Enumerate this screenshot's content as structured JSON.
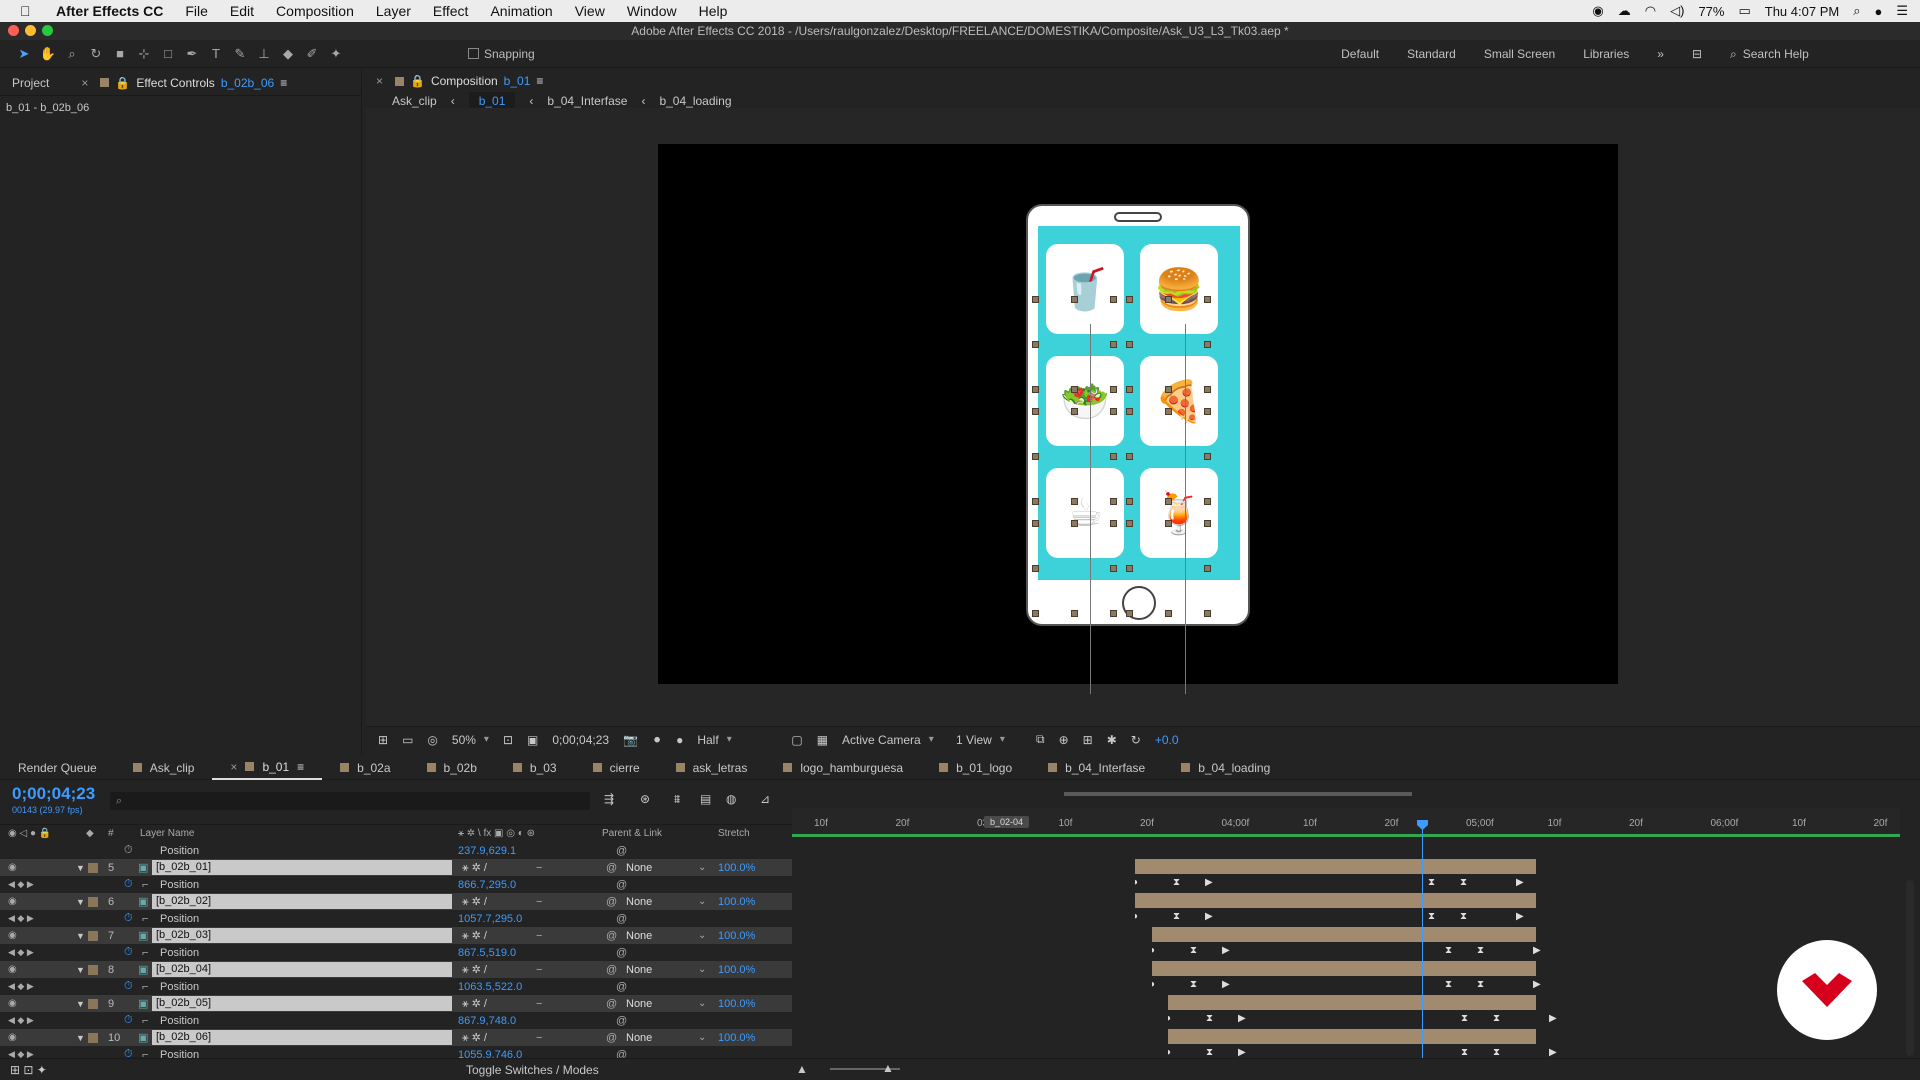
{
  "menubar": {
    "app": "After Effects CC",
    "items": [
      "File",
      "Edit",
      "Composition",
      "Layer",
      "Effect",
      "Animation",
      "View",
      "Window",
      "Help"
    ],
    "battery": "77%",
    "clock": "Thu 4:07 PM"
  },
  "window_title": "Adobe After Effects CC 2018 - /Users/raulgonzalez/Desktop/FREELANCE/DOMESTIKA/Composite/Ask_U3_L3_Tk03.aep *",
  "toolbar": {
    "snapping": "Snapping",
    "workspaces": [
      "Default",
      "Standard",
      "Small Screen",
      "Libraries"
    ],
    "search_placeholder": "Search Help"
  },
  "left_panel": {
    "tab_project": "Project",
    "tab_effect_controls": "Effect Controls",
    "effect_layer": "b_02b_06",
    "path": "b_01 - b_02b_06"
  },
  "comp_panel": {
    "tab_label": "Composition",
    "comp_name": "b_01",
    "crumbs": [
      "Ask_clip",
      "b_01",
      "b_04_Interfase",
      "b_04_loading"
    ]
  },
  "viewer_footer": {
    "zoom": "50%",
    "timecode": "0;00;04;23",
    "resolution": "Half",
    "camera": "Active Camera",
    "views": "1 View",
    "exposure": "+0.0"
  },
  "timeline_tabs": [
    "Render Queue",
    "Ask_clip",
    "b_01",
    "b_02a",
    "b_02b",
    "b_03",
    "cierre",
    "ask_letras",
    "logo_hamburguesa",
    "b_01_logo",
    "b_04_Interfase",
    "b_04_loading"
  ],
  "timeline": {
    "timecode": "0;00;04;23",
    "frame_info": "00143 (29.97 fps)",
    "col_layer_name": "Layer Name",
    "col_parent": "Parent & Link",
    "col_stretch": "Stretch",
    "col_hash": "#",
    "ruler_labels": [
      "10f",
      "20f",
      "03;00f",
      "10f",
      "20f",
      "04;00f",
      "10f",
      "20f",
      "05;00f",
      "10f",
      "20f",
      "06;00f",
      "10f",
      "20f"
    ],
    "marker_label": "b_02-04",
    "rows": [
      {
        "kind": "prop",
        "name": "Position",
        "value": "237.9,629.1"
      },
      {
        "kind": "layer",
        "num": "5",
        "name": "[b_02b_01]",
        "parent": "None",
        "stretch": "100.0%"
      },
      {
        "kind": "prop",
        "name": "Position",
        "value": "866.7,295.0"
      },
      {
        "kind": "layer",
        "num": "6",
        "name": "[b_02b_02]",
        "parent": "None",
        "stretch": "100.0%"
      },
      {
        "kind": "prop",
        "name": "Position",
        "value": "1057.7,295.0"
      },
      {
        "kind": "layer",
        "num": "7",
        "name": "[b_02b_03]",
        "parent": "None",
        "stretch": "100.0%"
      },
      {
        "kind": "prop",
        "name": "Position",
        "value": "867.5,519.0"
      },
      {
        "kind": "layer",
        "num": "8",
        "name": "[b_02b_04]",
        "parent": "None",
        "stretch": "100.0%"
      },
      {
        "kind": "prop",
        "name": "Position",
        "value": "1063.5,522.0"
      },
      {
        "kind": "layer",
        "num": "9",
        "name": "[b_02b_05]",
        "parent": "None",
        "stretch": "100.0%"
      },
      {
        "kind": "prop",
        "name": "Position",
        "value": "867.9,748.0"
      },
      {
        "kind": "layer",
        "num": "10",
        "name": "[b_02b_06]",
        "parent": "None",
        "stretch": "100.0%"
      },
      {
        "kind": "prop",
        "name": "Position",
        "value": "1055.9,746.0"
      }
    ]
  },
  "footer": {
    "toggle": "Toggle Switches / Modes"
  },
  "colors": {
    "accent": "#3d9bff",
    "layer_bar": "#a18a6e",
    "screen": "#3dd1d9",
    "brand": "#d6001c"
  }
}
